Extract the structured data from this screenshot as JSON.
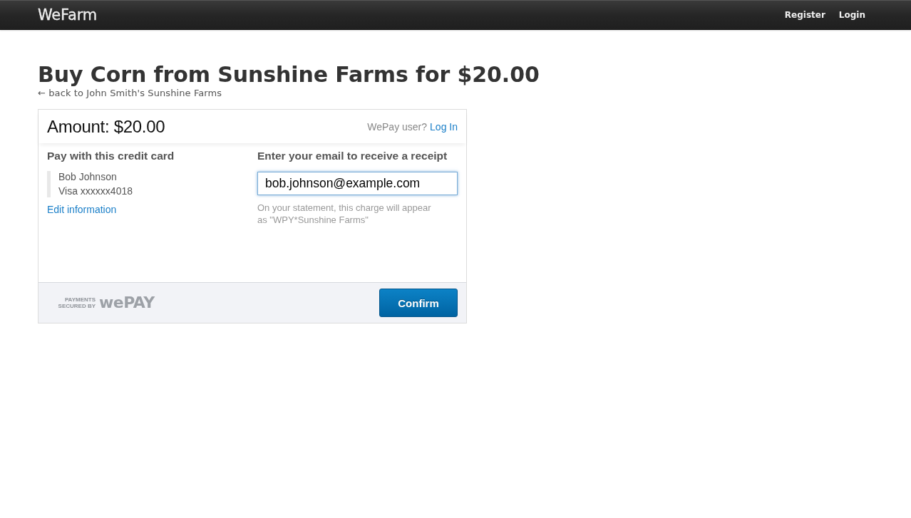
{
  "navbar": {
    "brand": "WeFarm",
    "links": [
      "Register",
      "Login"
    ]
  },
  "page": {
    "title": "Buy Corn from Sunshine Farms for $20.00",
    "back_link": "← back to John Smith's Sunshine Farms"
  },
  "payment_form": {
    "amount": "Amount: $20.00",
    "login_prompt": "WePay user?",
    "login_link": "Log In",
    "card_section": {
      "heading": "Pay with this credit card",
      "card_holder": "Bob Johnson",
      "card_number": "Visa xxxxxx4018",
      "edit_link": "Edit information"
    },
    "email_section": {
      "heading": "Enter your email to receive a receipt",
      "email_field": {
        "value": "bob.johnson@example.com",
        "focused": true
      },
      "note": "On your statement, this charge will appear as \"WPY*Sunshine Farms\""
    },
    "footer": {
      "secured_by": "PAYMENTS SECURED BY",
      "logo": "wePAY",
      "confirm_button": "Confirm"
    }
  }
}
